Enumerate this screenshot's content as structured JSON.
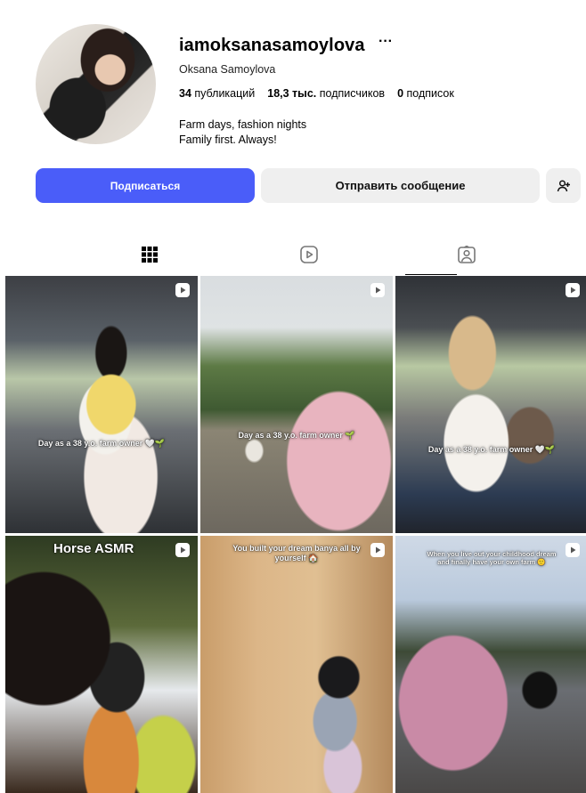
{
  "profile": {
    "username": "iamoksanasamoylova",
    "full_name": "Oksana Samoylova",
    "stats": {
      "posts_count": "34",
      "posts_label": "публикаций",
      "followers_count": "18,3 тыс.",
      "followers_label": "подписчиков",
      "following_count": "0",
      "following_label": "подписок"
    },
    "bio": [
      "Farm days, fashion nights",
      "Family first. Always!"
    ]
  },
  "actions": {
    "follow_label": "Подписаться",
    "message_label": "Отправить сообщение",
    "more_label": "···"
  },
  "tabs": [
    {
      "name": "posts",
      "icon": "grid-icon",
      "active": false
    },
    {
      "name": "reels",
      "icon": "reels-icon",
      "active": false
    },
    {
      "name": "tagged",
      "icon": "tagged-icon",
      "active": true
    }
  ],
  "posts": [
    {
      "caption": "Day as a 38 y.o. farm owner 🤍🌱",
      "type": "reel"
    },
    {
      "caption": "Day as a 38 y.o. farm owner 🌱",
      "type": "reel"
    },
    {
      "caption": "Day as a 38 y.o. farm owner 🤍🌱",
      "type": "reel"
    },
    {
      "caption": "Horse ASMR",
      "type": "reel"
    },
    {
      "caption": "You built your dream banya all by yourself 🏠",
      "type": "reel"
    },
    {
      "caption": "When you live out your childhood dream and finally have your own farm 🙂",
      "type": "reel"
    }
  ],
  "colors": {
    "accent": "#4a5df9",
    "secondary_button": "#efefef"
  }
}
